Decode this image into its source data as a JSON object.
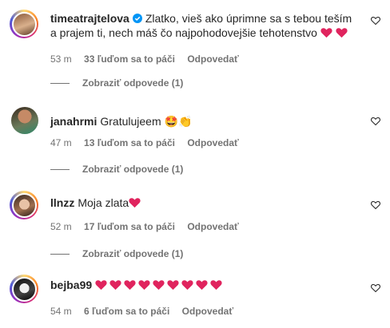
{
  "colors": {
    "heart": "#e0245e",
    "verified": "#0095f6",
    "muted": "#737373"
  },
  "comments": [
    {
      "username": "timeatrajtelova",
      "verified": true,
      "text": "Zlatko, vieš ako úprimne sa s tebou teším a prajem ti, nech máš čo najpohodovejšie tehotenstvo",
      "trailing_hearts": 2,
      "time": "53 m",
      "likes": "33 ľuďom sa to páči",
      "reply": "Odpovedať",
      "view_replies": "Zobraziť odpovede (1)"
    },
    {
      "username": "janahrmi",
      "text": "Gratulujeem",
      "emojis": "🤩👏",
      "time": "47 m",
      "likes": "13 ľuďom sa to páči",
      "reply": "Odpovedať",
      "view_replies": "Zobraziť odpovede (1)"
    },
    {
      "username": "llnzz",
      "text": "Moja zlata",
      "trailing_hearts": 1,
      "time": "52 m",
      "likes": "17 ľuďom sa to páči",
      "reply": "Odpovedať",
      "view_replies": "Zobraziť odpovede (1)"
    },
    {
      "username": "bejba99",
      "text": "",
      "trailing_hearts": 9,
      "time": "54 m",
      "likes": "6 ľuďom sa to páči",
      "reply": "Odpovedať"
    }
  ]
}
